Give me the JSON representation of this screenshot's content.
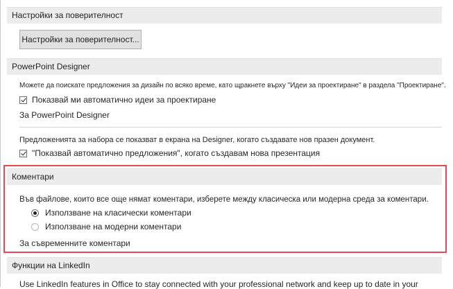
{
  "privacy": {
    "header": "Настройки за поверителност",
    "button_label": "Настройки за поверителност..."
  },
  "designer": {
    "header": "PowerPoint Designer",
    "description": "Можете да поискате предложения за дизайн по всяко време, като щракнете върху \"Идеи за проектиране\" в раздела \"Проектиране\".",
    "auto_ideas_label": "Показвай ми автоматично идеи за проектиране",
    "about_link": "За PowerPoint Designer",
    "suggestions_description": "Предложенията за набора се показват в екрана на Designer, когато създавате нов празен документ.",
    "auto_suggestions_label": "\"Показвай автоматично предложения\", когато създавам нова презентация"
  },
  "comments": {
    "header": "Коментари",
    "description": "Във файлове, които все още нямат коментари, изберете между класическа или модерна среда за коментари.",
    "options": [
      {
        "label": "Използване на класически коментари",
        "selected": true
      },
      {
        "label": "Използване на модерни коментари",
        "selected": false
      }
    ],
    "about_link": "За съвременните коментари"
  },
  "linkedin": {
    "header": "Функции на LinkedIn",
    "description": "Use LinkedIn features in Office to stay connected with your professional network and keep up to date in your"
  },
  "colors": {
    "highlight": "#e64650",
    "header_bg": "#ececec"
  }
}
